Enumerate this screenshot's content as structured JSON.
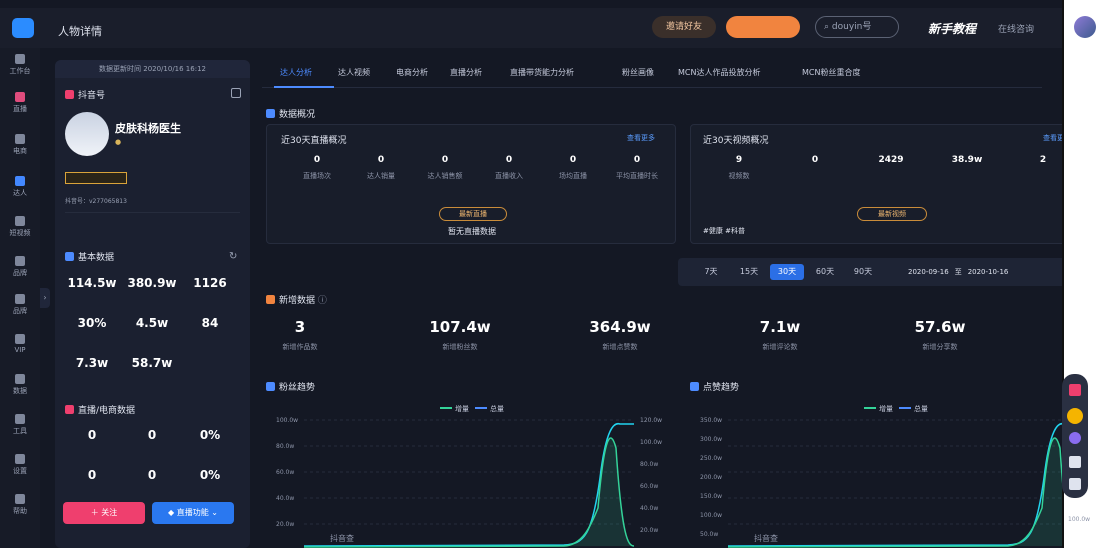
{
  "header": {
    "page_title": "人物详情",
    "promo_btn": "邀请好友",
    "cta_btn": "",
    "search_placeholder": "douyin号",
    "guide": "新手教程",
    "help": "在线咨询"
  },
  "sidebar": [
    {
      "label": "工作台"
    },
    {
      "label": "直播"
    },
    {
      "label": "电商"
    },
    {
      "label": "达人"
    },
    {
      "label": "短视频"
    },
    {
      "label": "品牌"
    },
    {
      "label": "品牌"
    },
    {
      "label": "VIP"
    },
    {
      "label": "数据"
    },
    {
      "label": "工具"
    },
    {
      "label": "设置"
    },
    {
      "label": "帮助"
    }
  ],
  "profile": {
    "update_time": "数据更新时间 2020/10/16 16:12",
    "platform": "抖音号",
    "name": "皮肤科杨医生",
    "verify": "",
    "badge": "",
    "id_line": "抖音号：v277065813",
    "base_title": "基本数据",
    "base": [
      {
        "value": "114.5w",
        "label": ""
      },
      {
        "value": "380.9w",
        "label": ""
      },
      {
        "value": "1126",
        "label": ""
      },
      {
        "value": "30%",
        "label": ""
      },
      {
        "value": "4.5w",
        "label": ""
      },
      {
        "value": "84",
        "label": ""
      },
      {
        "value": "7.3w",
        "label": ""
      },
      {
        "value": "58.7w",
        "label": ""
      }
    ],
    "live_title": "直播/电商数据",
    "live": [
      {
        "value": "0",
        "label": ""
      },
      {
        "value": "0",
        "label": ""
      },
      {
        "value": "0%",
        "label": ""
      },
      {
        "value": "0",
        "label": ""
      },
      {
        "value": "0",
        "label": ""
      },
      {
        "value": "0%",
        "label": ""
      }
    ],
    "follow_btn": "关注",
    "live_btn": "直播功能"
  },
  "tabs": [
    "达人分析",
    "达人视频",
    "电商分析",
    "直播分析",
    "直播带货能力分析",
    "粉丝画像",
    "MCN达人作品投放分析",
    "MCN粉丝重合度"
  ],
  "overview_title": "数据概况",
  "live_panel": {
    "title": "近30天直播概况",
    "more": "查看更多",
    "stats": [
      {
        "value": "0",
        "label": "直播场次"
      },
      {
        "value": "0",
        "label": "达人销量"
      },
      {
        "value": "0",
        "label": "达人销售额"
      },
      {
        "value": "0",
        "label": "直播收入"
      },
      {
        "value": "0",
        "label": "场均直播"
      },
      {
        "value": "0",
        "label": "平均直播时长"
      }
    ],
    "pill": "最新直播",
    "empty": "暂无直播数据"
  },
  "video_panel": {
    "title": "近30天视频概况",
    "more": "查看更多",
    "stats": [
      {
        "value": "9",
        "label": "视频数"
      },
      {
        "value": "0",
        "label": ""
      },
      {
        "value": "2429",
        "label": ""
      },
      {
        "value": "38.9w",
        "label": ""
      },
      {
        "value": "2",
        "label": ""
      }
    ],
    "pill": "最新视频",
    "desc": "#健康 #科普"
  },
  "range": {
    "options": [
      "7天",
      "15天",
      "30天",
      "60天",
      "90天"
    ],
    "active": 2,
    "start": "2020-09-16",
    "to": "至",
    "end": "2020-10-16"
  },
  "new_title": "新增数据",
  "new_stats": [
    {
      "value": "3",
      "label": "新增作品数"
    },
    {
      "value": "107.4w",
      "label": "新增粉丝数"
    },
    {
      "value": "364.9w",
      "label": "新增点赞数"
    },
    {
      "value": "7.1w",
      "label": "新增评论数"
    },
    {
      "value": "57.6w",
      "label": "新增分享数"
    }
  ],
  "charts": [
    {
      "title": "粉丝趋势",
      "legend": [
        "增量",
        "总量"
      ],
      "left_ticks": [
        "100.0w",
        "80.0w",
        "60.0w",
        "40.0w",
        "20.0w"
      ],
      "right_ticks": [
        "120.0w",
        "100.0w",
        "80.0w",
        "60.0w",
        "40.0w",
        "20.0w"
      ],
      "watermark": "抖音查"
    },
    {
      "title": "点赞趋势",
      "legend": [
        "增量",
        "总量"
      ],
      "left_ticks": [
        "350.0w",
        "300.0w",
        "250.0w",
        "200.0w",
        "150.0w",
        "100.0w",
        "50.0w"
      ],
      "right_ticks": [
        "100.0w"
      ],
      "watermark": "抖音查"
    }
  ],
  "colors": {
    "accent": "#4d8bff",
    "bg": "#141824",
    "pink": "#ef3f6e",
    "green": "#34d399",
    "teal": "#22d3ee"
  }
}
